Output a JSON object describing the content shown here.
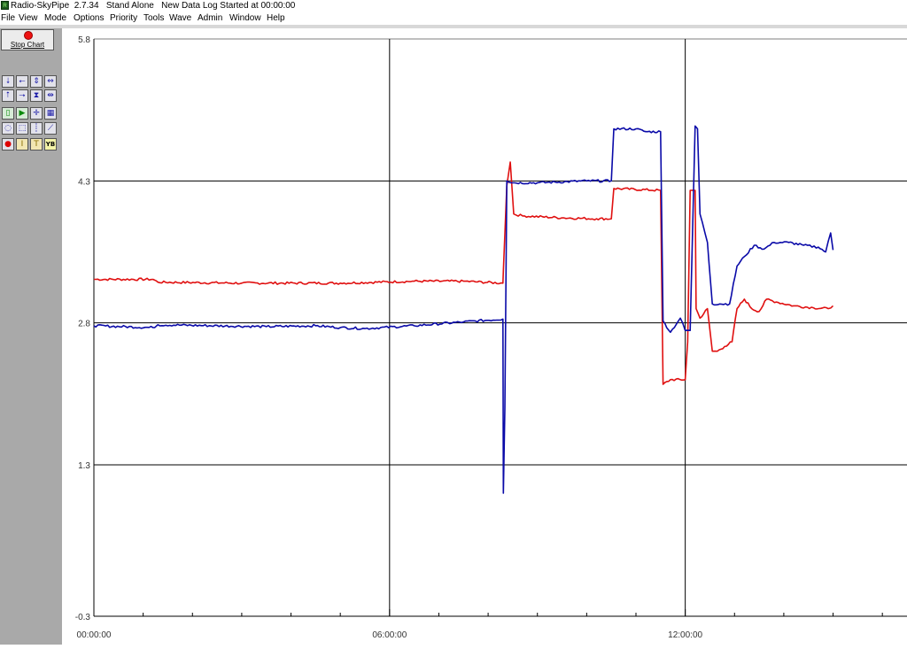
{
  "title_bar": {
    "app_name": "Radio-SkyPipe",
    "version": "2.7.34",
    "mode": "Stand Alone",
    "status": "New Data Log Started at 00:00:00"
  },
  "menu": [
    "File",
    "View",
    "Mode",
    "Options",
    "Priority",
    "Tools",
    "Wave",
    "Admin",
    "Window",
    "Help"
  ],
  "toolbar": {
    "stop_label": "Stop Chart",
    "buttons": [
      {
        "icon": "arrow-down-icon",
        "glyph": "⭣"
      },
      {
        "icon": "arrow-left-icon",
        "glyph": "⭠"
      },
      {
        "icon": "expand-vertical-icon",
        "glyph": "⇕"
      },
      {
        "icon": "expand-horizontal-icon",
        "glyph": "⇔"
      },
      {
        "icon": "arrow-up-icon",
        "glyph": "⭡"
      },
      {
        "icon": "arrow-right-icon",
        "glyph": "⭢"
      },
      {
        "icon": "compress-vertical-icon",
        "glyph": "⧗"
      },
      {
        "icon": "compress-horizontal-icon",
        "glyph": "⇹"
      },
      {
        "icon": "clipboard-icon",
        "glyph": "▯"
      },
      {
        "icon": "play-icon",
        "glyph": "▶"
      },
      {
        "icon": "crosshair-icon",
        "glyph": "✛"
      },
      {
        "icon": "grid-icon",
        "glyph": "▦"
      },
      {
        "icon": "zoom-icon",
        "glyph": "◌"
      },
      {
        "icon": "select-box-icon",
        "glyph": "⬚"
      },
      {
        "icon": "marker-icon",
        "glyph": "┊"
      },
      {
        "icon": "plot-icon",
        "glyph": "⟋"
      },
      {
        "icon": "record-icon",
        "glyph": "●"
      },
      {
        "icon": "info-icon",
        "glyph": "I"
      },
      {
        "icon": "text-icon",
        "glyph": "T"
      },
      {
        "icon": "yb-icon",
        "glyph": "YB"
      }
    ]
  },
  "colors": {
    "series_red": "#e01010",
    "series_blue": "#0a0aa8",
    "grid": "#000000",
    "sidebar": "#a9a9a9"
  },
  "chart_data": {
    "type": "line",
    "xlabel": "",
    "ylabel": "",
    "ylim": [
      -0.3,
      5.8
    ],
    "yticks": [
      "5.8",
      "4.3",
      "2.8",
      "1.3",
      "-0.3"
    ],
    "xlim_hours": [
      0,
      16.5
    ],
    "xticks": [
      "00:00:00",
      "06:00:00",
      "12:00:00"
    ],
    "grid": true,
    "series": [
      {
        "color": "#e01010",
        "points": [
          [
            0.0,
            3.26
          ],
          [
            1.2,
            3.26
          ],
          [
            1.3,
            3.23
          ],
          [
            3.0,
            3.22
          ],
          [
            5.0,
            3.22
          ],
          [
            6.5,
            3.24
          ],
          [
            7.5,
            3.24
          ],
          [
            8.3,
            3.22
          ],
          [
            8.31,
            3.35
          ],
          [
            8.38,
            4.25
          ],
          [
            8.45,
            4.5
          ],
          [
            8.52,
            3.95
          ],
          [
            8.7,
            3.93
          ],
          [
            9.5,
            3.91
          ],
          [
            10.2,
            3.9
          ],
          [
            10.5,
            3.9
          ],
          [
            10.55,
            4.22
          ],
          [
            11.5,
            4.2
          ],
          [
            11.55,
            2.15
          ],
          [
            11.7,
            2.2
          ],
          [
            12.0,
            2.2
          ],
          [
            12.05,
            2.6
          ],
          [
            12.1,
            4.2
          ],
          [
            12.2,
            4.2
          ],
          [
            12.22,
            2.95
          ],
          [
            12.3,
            2.85
          ],
          [
            12.45,
            2.95
          ],
          [
            12.55,
            2.5
          ],
          [
            12.65,
            2.5
          ],
          [
            12.8,
            2.55
          ],
          [
            12.95,
            2.6
          ],
          [
            13.05,
            2.95
          ],
          [
            13.2,
            3.05
          ],
          [
            13.35,
            2.95
          ],
          [
            13.5,
            2.92
          ],
          [
            13.65,
            3.05
          ],
          [
            13.85,
            3.02
          ],
          [
            14.2,
            2.98
          ],
          [
            14.6,
            2.96
          ],
          [
            14.9,
            2.95
          ],
          [
            15.0,
            2.98
          ]
        ]
      },
      {
        "color": "#0a0aa8",
        "points": [
          [
            0.0,
            2.77
          ],
          [
            1.2,
            2.75
          ],
          [
            1.3,
            2.78
          ],
          [
            3.5,
            2.76
          ],
          [
            4.5,
            2.77
          ],
          [
            5.0,
            2.75
          ],
          [
            5.5,
            2.74
          ],
          [
            6.5,
            2.77
          ],
          [
            7.5,
            2.81
          ],
          [
            8.3,
            2.84
          ],
          [
            8.31,
            1.0
          ],
          [
            8.34,
            1.9
          ],
          [
            8.38,
            4.3
          ],
          [
            8.5,
            4.28
          ],
          [
            9.0,
            4.28
          ],
          [
            10.0,
            4.3
          ],
          [
            10.5,
            4.3
          ],
          [
            10.55,
            4.85
          ],
          [
            11.0,
            4.85
          ],
          [
            11.2,
            4.82
          ],
          [
            11.5,
            4.82
          ],
          [
            11.55,
            2.82
          ],
          [
            11.7,
            2.7
          ],
          [
            11.9,
            2.85
          ],
          [
            12.0,
            2.72
          ],
          [
            12.1,
            2.72
          ],
          [
            12.2,
            4.88
          ],
          [
            12.25,
            4.85
          ],
          [
            12.3,
            3.95
          ],
          [
            12.4,
            3.75
          ],
          [
            12.45,
            3.65
          ],
          [
            12.55,
            3.0
          ],
          [
            12.7,
            3.0
          ],
          [
            12.9,
            3.0
          ],
          [
            13.05,
            3.4
          ],
          [
            13.2,
            3.5
          ],
          [
            13.4,
            3.62
          ],
          [
            13.6,
            3.58
          ],
          [
            13.8,
            3.65
          ],
          [
            14.1,
            3.65
          ],
          [
            14.4,
            3.62
          ],
          [
            14.7,
            3.6
          ],
          [
            14.85,
            3.55
          ],
          [
            14.95,
            3.75
          ],
          [
            15.0,
            3.57
          ]
        ]
      }
    ]
  }
}
